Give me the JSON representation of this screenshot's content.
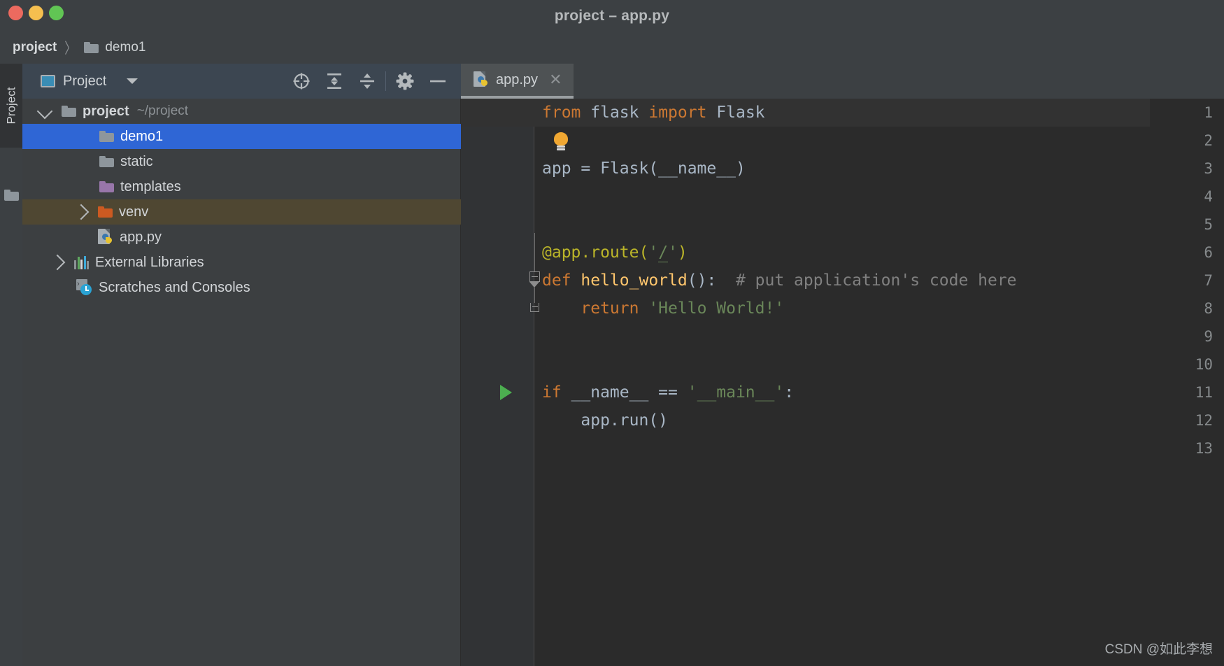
{
  "window": {
    "title": "project – app.py",
    "traffic_lights": [
      {
        "name": "close",
        "color": "#ec6a5f"
      },
      {
        "name": "minimize",
        "color": "#f5bf4f"
      },
      {
        "name": "maximize",
        "color": "#61c554"
      }
    ]
  },
  "breadcrumb": {
    "root": "project",
    "separator": "〉",
    "current": "demo1",
    "folder_icon": "folder-icon"
  },
  "tool_stripe": {
    "tab_label": "Project",
    "folder_icon": "folder-icon"
  },
  "project_panel": {
    "title": "Project",
    "title_icon": "project-window-icon",
    "dropdown_icon": "chevron-down-icon",
    "tools": [
      {
        "name": "locate-icon",
        "label": "Select Opened File"
      },
      {
        "name": "expand-all-icon",
        "label": "Expand All"
      },
      {
        "name": "collapse-all-icon",
        "label": "Collapse All"
      },
      {
        "name": "gear-icon",
        "label": "Settings"
      },
      {
        "name": "hide-icon",
        "label": "Hide"
      }
    ],
    "tree": [
      {
        "label": "project",
        "sub": "~/project",
        "icon": "folder-icon",
        "icon_color": "#8e969c",
        "indent": 0,
        "twisty": "down",
        "state": "normal",
        "bold": true
      },
      {
        "label": "demo1",
        "sub": "",
        "icon": "folder-icon",
        "icon_color": "#8e969c",
        "indent": 1,
        "twisty": "none",
        "state": "selected",
        "bold": false
      },
      {
        "label": "static",
        "sub": "",
        "icon": "folder-icon",
        "icon_color": "#8e969c",
        "indent": 1,
        "twisty": "none",
        "state": "normal",
        "bold": false
      },
      {
        "label": "templates",
        "sub": "",
        "icon": "folder-icon",
        "icon_color": "#9876aa",
        "indent": 1,
        "twisty": "none",
        "state": "normal",
        "bold": false
      },
      {
        "label": "venv",
        "sub": "",
        "icon": "folder-icon",
        "icon_color": "#cc5a21",
        "indent": 1,
        "twisty": "right",
        "state": "hovered",
        "bold": false
      },
      {
        "label": "app.py",
        "sub": "",
        "icon": "python-file-icon",
        "icon_color": "",
        "indent": 1,
        "twisty": "none",
        "state": "normal",
        "bold": false
      },
      {
        "label": "External Libraries",
        "sub": "",
        "icon": "external-libraries-icon",
        "icon_color": "",
        "indent": 0,
        "twisty": "right",
        "state": "normal",
        "bold": false
      },
      {
        "label": "Scratches and Consoles",
        "sub": "",
        "icon": "scratches-icon",
        "icon_color": "",
        "indent": 0,
        "twisty": "none",
        "state": "normal",
        "bold": false
      }
    ]
  },
  "editor": {
    "tabs": [
      {
        "label": "app.py",
        "icon": "python-file-icon",
        "close_icon": "close-icon",
        "active": true
      }
    ],
    "gutter": {
      "line_numbers": [
        "1",
        "2",
        "3",
        "4",
        "5",
        "6",
        "7",
        "8",
        "9",
        "10",
        "11",
        "12",
        "13"
      ],
      "run_arrow_line": 11,
      "fold_lines": [
        7,
        8
      ]
    },
    "intentions": {
      "bulb_icon": "lightbulb-icon",
      "bulb_line": 2
    },
    "caret_line": 1,
    "code": [
      {
        "line": 1,
        "tokens": [
          {
            "t": "from ",
            "c": "kw"
          },
          {
            "t": "flask ",
            "c": "txt"
          },
          {
            "t": "import ",
            "c": "kw"
          },
          {
            "t": "Flask",
            "c": "txt"
          }
        ]
      },
      {
        "line": 2,
        "tokens": []
      },
      {
        "line": 3,
        "tokens": [
          {
            "t": "app = Flask(__name__)",
            "c": "txt"
          }
        ]
      },
      {
        "line": 4,
        "tokens": []
      },
      {
        "line": 5,
        "tokens": []
      },
      {
        "line": 6,
        "tokens": [
          {
            "t": "@app.route(",
            "c": "dec"
          },
          {
            "t": "'",
            "c": "str"
          },
          {
            "t": "/",
            "c": "strpath"
          },
          {
            "t": "'",
            "c": "str"
          },
          {
            "t": ")",
            "c": "dec"
          }
        ]
      },
      {
        "line": 7,
        "tokens": [
          {
            "t": "def ",
            "c": "kw"
          },
          {
            "t": "hello_world",
            "c": "fn"
          },
          {
            "t": "():",
            "c": "txt"
          },
          {
            "t": "  # put application's code here",
            "c": "cmt"
          }
        ]
      },
      {
        "line": 8,
        "tokens": [
          {
            "t": "    return ",
            "c": "kw"
          },
          {
            "t": "'Hello World!'",
            "c": "str"
          }
        ]
      },
      {
        "line": 9,
        "tokens": []
      },
      {
        "line": 10,
        "tokens": []
      },
      {
        "line": 11,
        "tokens": [
          {
            "t": "if ",
            "c": "kw"
          },
          {
            "t": "__name__ == ",
            "c": "txt"
          },
          {
            "t": "'__main__'",
            "c": "str"
          },
          {
            "t": ":",
            "c": "txt"
          }
        ]
      },
      {
        "line": 12,
        "tokens": [
          {
            "t": "    app.run()",
            "c": "txt"
          }
        ]
      },
      {
        "line": 13,
        "tokens": []
      }
    ]
  },
  "watermark": "CSDN @如此李想",
  "colors": {
    "titlebar_bg": "#3c4043",
    "panel_header_bg": "#3c4651",
    "panel_bg": "#3c3f41",
    "editor_bg": "#2b2b2b",
    "gutter_bg": "#313335",
    "selection_blue": "#2f66d5",
    "hover_brown": "#4f4732",
    "tab_active_bg": "#4e5254"
  }
}
